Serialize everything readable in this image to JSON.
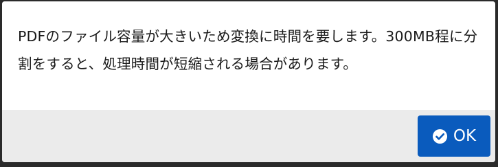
{
  "dialog": {
    "message": "PDFのファイル容量が大きいため変換に時間を要します。300MB程に分割をすると、処理時間が短縮される場合があります。",
    "ok_button": {
      "icon": "check-circle-icon",
      "label": "OK"
    }
  },
  "colors": {
    "button_bg": "#0a5bbd",
    "footer_bg": "#ebebeb",
    "body_bg": "#ffffff"
  }
}
